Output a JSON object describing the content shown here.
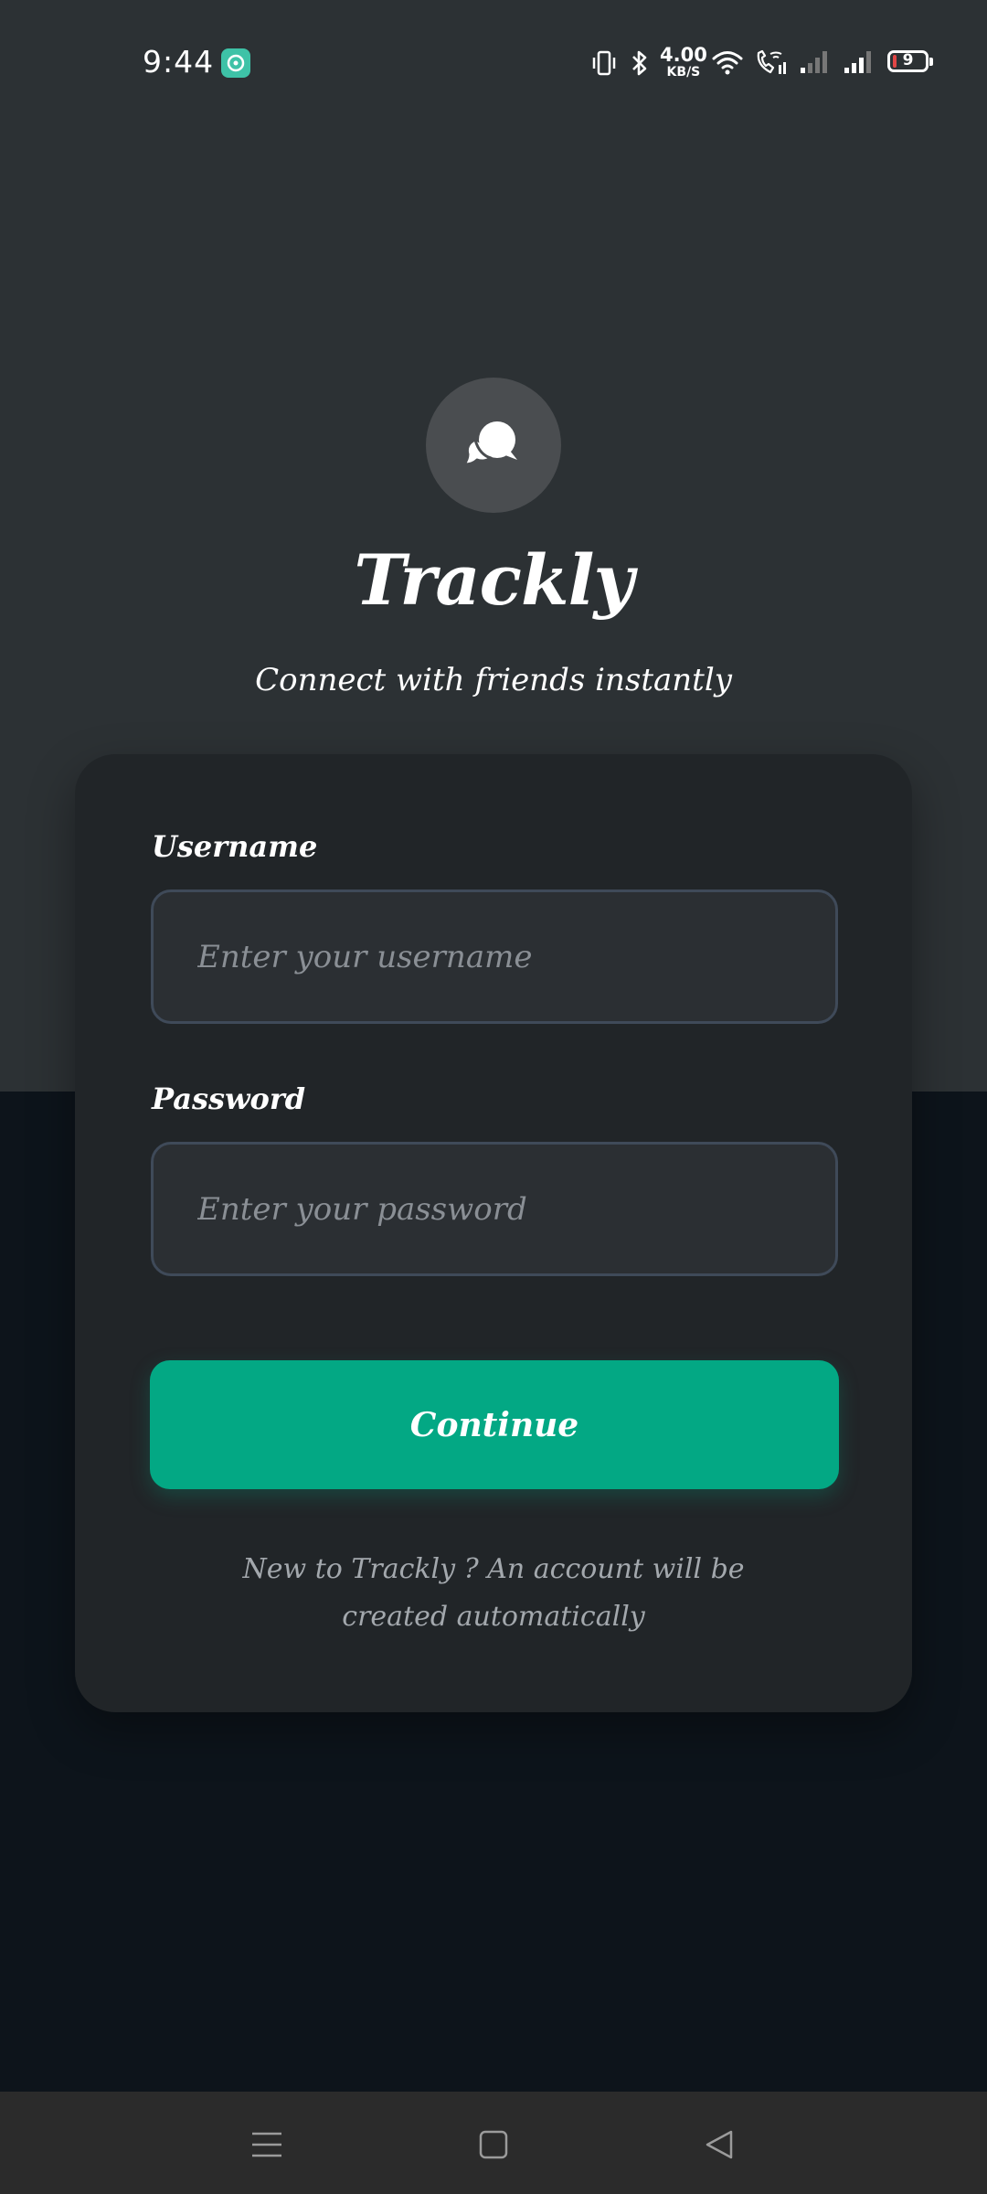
{
  "status_bar": {
    "time": "9:44",
    "net_speed_value": "4.00",
    "net_speed_unit": "KB/S",
    "battery_level": "9",
    "icons": [
      "app-notification-icon",
      "vibrate-icon",
      "bluetooth-icon",
      "wifi-icon",
      "wifi-call-icon",
      "signal-weak-icon",
      "signal-icon",
      "battery-icon"
    ]
  },
  "brand": {
    "logo_icon": "chat-bubbles-icon",
    "title": "Trackly",
    "subtitle": "Connect with friends instantly"
  },
  "login": {
    "username_label": "Username",
    "username_value": "",
    "username_placeholder": "Enter your username",
    "password_label": "Password",
    "password_value": "",
    "password_placeholder": "Enter your password",
    "continue_label": "Continue",
    "helper_text": "New to Trackly ?  An account will be created automatically"
  },
  "nav_bar": {
    "icons": [
      "menu-icon",
      "home-icon",
      "back-icon"
    ]
  },
  "colors": {
    "top_background": "#2c3134",
    "bottom_background": "#0d141b",
    "card_background": "#212528",
    "input_border": "#3f4a59",
    "accent": "#03a884",
    "helper_text": "#a3a8ad"
  }
}
